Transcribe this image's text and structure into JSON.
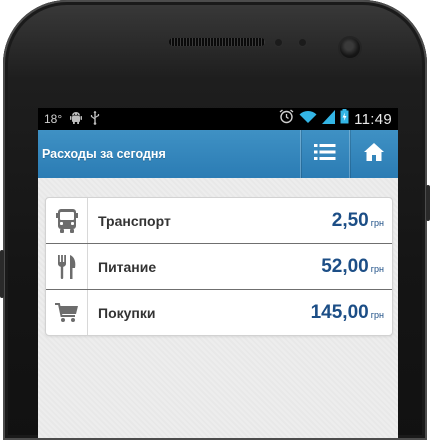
{
  "status_bar": {
    "temperature": "18°",
    "time": "11:49",
    "left_icons": [
      "android-debug-icon",
      "usb-icon"
    ],
    "right_icons": [
      "alarm-icon",
      "wifi-icon",
      "signal-icon",
      "battery-icon"
    ]
  },
  "action_bar": {
    "title": "Расходы за сегодня",
    "buttons": [
      "list-icon",
      "home-icon"
    ],
    "color": "#2f83bb"
  },
  "expenses": [
    {
      "icon": "bus-icon",
      "label": "Транспорт",
      "amount": "2,50",
      "currency": "грн"
    },
    {
      "icon": "fork-knife-icon",
      "label": "Питание",
      "amount": "52,00",
      "currency": "грн"
    },
    {
      "icon": "shopping-cart-icon",
      "label": "Покупки",
      "amount": "145,00",
      "currency": "грн"
    }
  ],
  "colors": {
    "amount": "#1c4e86",
    "label": "#333333"
  }
}
